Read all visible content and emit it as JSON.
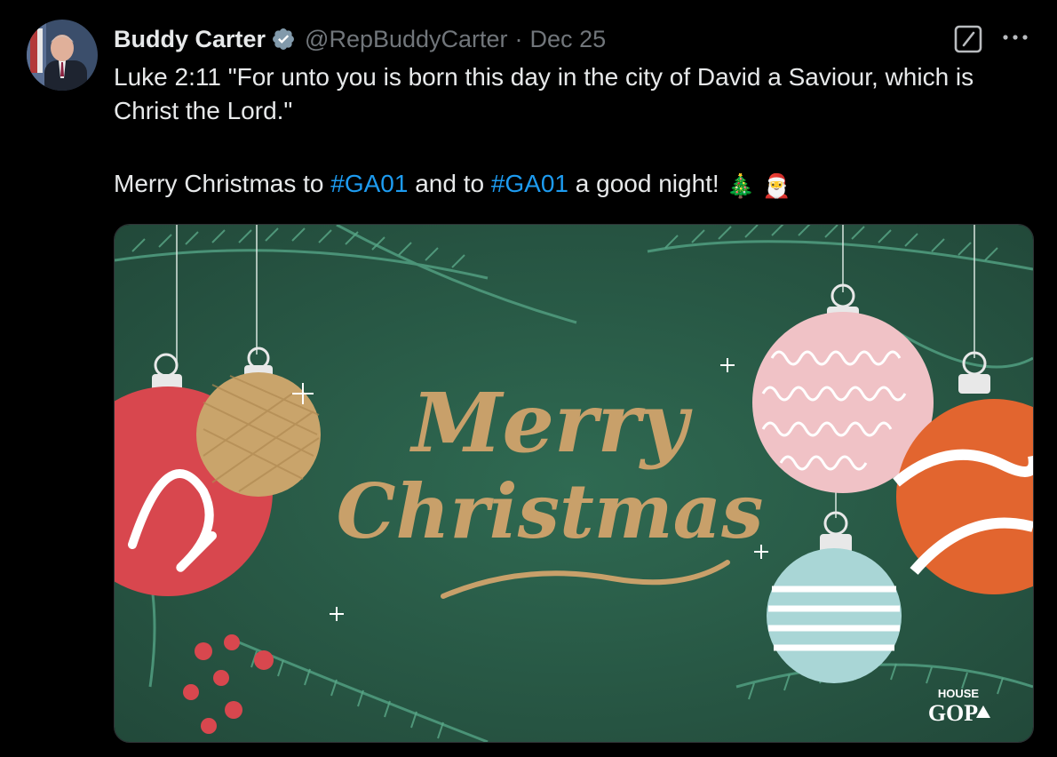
{
  "tweet": {
    "author_name": "Buddy Carter",
    "handle": "@RepBuddyCarter",
    "separator": "·",
    "date": "Dec 25",
    "text_line1": "Luke 2:11 \"For unto you is born this day in the city of David a Saviour, which is Christ the Lord.\"",
    "text_line2_part1": "Merry Christmas to ",
    "hashtag1": "#GA01",
    "text_line2_part2": " and to ",
    "hashtag2": "#GA01",
    "text_line2_part3": " a good night!",
    "emoji1": "🎄",
    "emoji2": "🎅"
  },
  "media": {
    "headline_word1": "Merry",
    "headline_word2": "Christmas",
    "logo_top": "HOUSE",
    "logo_bottom": "GOP"
  },
  "icons": {
    "verified": "verified-badge-icon",
    "grok": "grok-icon",
    "more": "more-dots-icon"
  },
  "colors": {
    "background": "#000000",
    "text": "#e7e9ea",
    "secondary": "#71767b",
    "link": "#1d9bf0",
    "verified": "#829aab",
    "card_green": "#2d5d48",
    "gold": "#c8a06a"
  }
}
